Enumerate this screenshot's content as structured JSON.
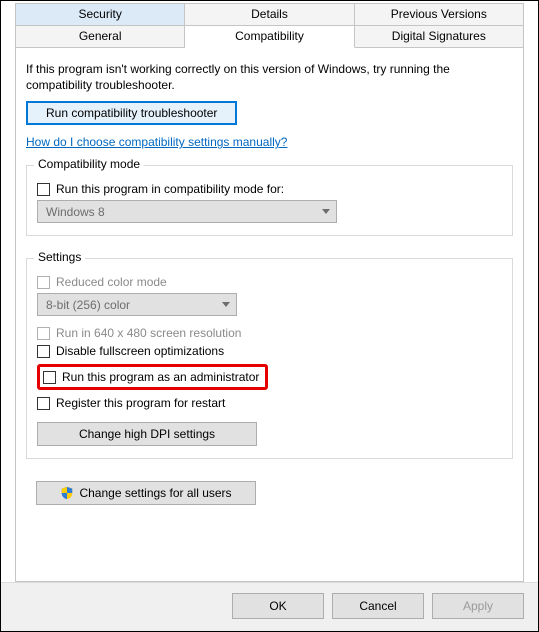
{
  "tabs": {
    "row1": [
      "Security",
      "Details",
      "Previous Versions"
    ],
    "row2": [
      "General",
      "Compatibility",
      "Digital Signatures"
    ],
    "active": "Compatibility",
    "topActive": "Security"
  },
  "intro": "If this program isn't working correctly on this version of Windows, try running the compatibility troubleshooter.",
  "troubleshootBtn": "Run compatibility troubleshooter",
  "helpLink": "How do I choose compatibility settings manually?",
  "compatMode": {
    "title": "Compatibility mode",
    "checkbox": "Run this program in compatibility mode for:",
    "select": "Windows 8"
  },
  "settings": {
    "title": "Settings",
    "reducedColor": "Reduced color mode",
    "colorSelect": "8-bit (256) color",
    "lowRes": "Run in 640 x 480 screen resolution",
    "disableFS": "Disable fullscreen optimizations",
    "runAdmin": "Run this program as an administrator",
    "registerRestart": "Register this program for restart",
    "dpiBtn": "Change high DPI settings"
  },
  "allUsersBtn": "Change settings for all users",
  "dialog": {
    "ok": "OK",
    "cancel": "Cancel",
    "apply": "Apply"
  }
}
